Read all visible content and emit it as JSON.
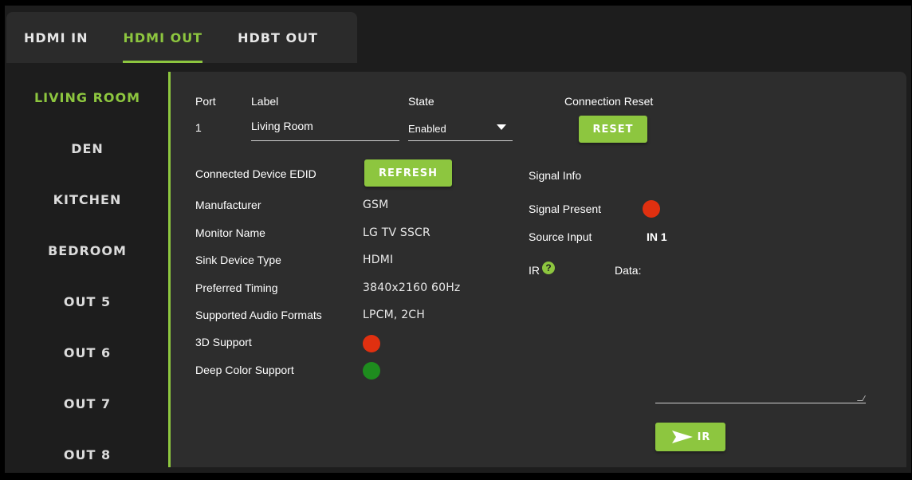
{
  "tabs": [
    {
      "label": "HDMI IN",
      "active": false
    },
    {
      "label": "HDMI OUT",
      "active": true
    },
    {
      "label": "HDBT OUT",
      "active": false
    }
  ],
  "sidebar": {
    "items": [
      {
        "label": "LIVING ROOM",
        "active": true
      },
      {
        "label": "DEN",
        "active": false
      },
      {
        "label": "KITCHEN",
        "active": false
      },
      {
        "label": "BEDROOM",
        "active": false
      },
      {
        "label": "OUT 5",
        "active": false
      },
      {
        "label": "OUT 6",
        "active": false
      },
      {
        "label": "OUT 7",
        "active": false
      },
      {
        "label": "OUT 8",
        "active": false
      }
    ]
  },
  "port": {
    "port_header": "Port",
    "label_header": "Label",
    "state_header": "State",
    "reset_header": "Connection Reset",
    "port_value": "1",
    "label_value": "Living Room",
    "state_value": "Enabled",
    "reset_button": "RESET"
  },
  "edid": {
    "title": "Connected Device EDID",
    "refresh_button": "REFRESH",
    "manufacturer_label": "Manufacturer",
    "manufacturer_value": "GSM",
    "monitor_name_label": "Monitor Name",
    "monitor_name_value": "LG TV SSCR",
    "sink_type_label": "Sink Device Type",
    "sink_type_value": "HDMI",
    "timing_label": "Preferred Timing",
    "timing_value": "3840x2160 60Hz",
    "audio_label": "Supported Audio Formats",
    "audio_value": "LPCM, 2CH",
    "support_3d_label": "3D Support",
    "deep_color_label": "Deep Color Support"
  },
  "signal": {
    "title": "Signal Info",
    "present_label": "Signal Present",
    "source_label": "Source Input",
    "source_value": "IN 1",
    "ir_label": "IR",
    "ir_help": "?",
    "data_label": "Data:",
    "send_ir_button": "IR"
  },
  "colors": {
    "accent": "#8dc63f",
    "status_off": "#e03010",
    "status_on": "#1e8c1e",
    "panel_bg": "#2d2d2d"
  }
}
